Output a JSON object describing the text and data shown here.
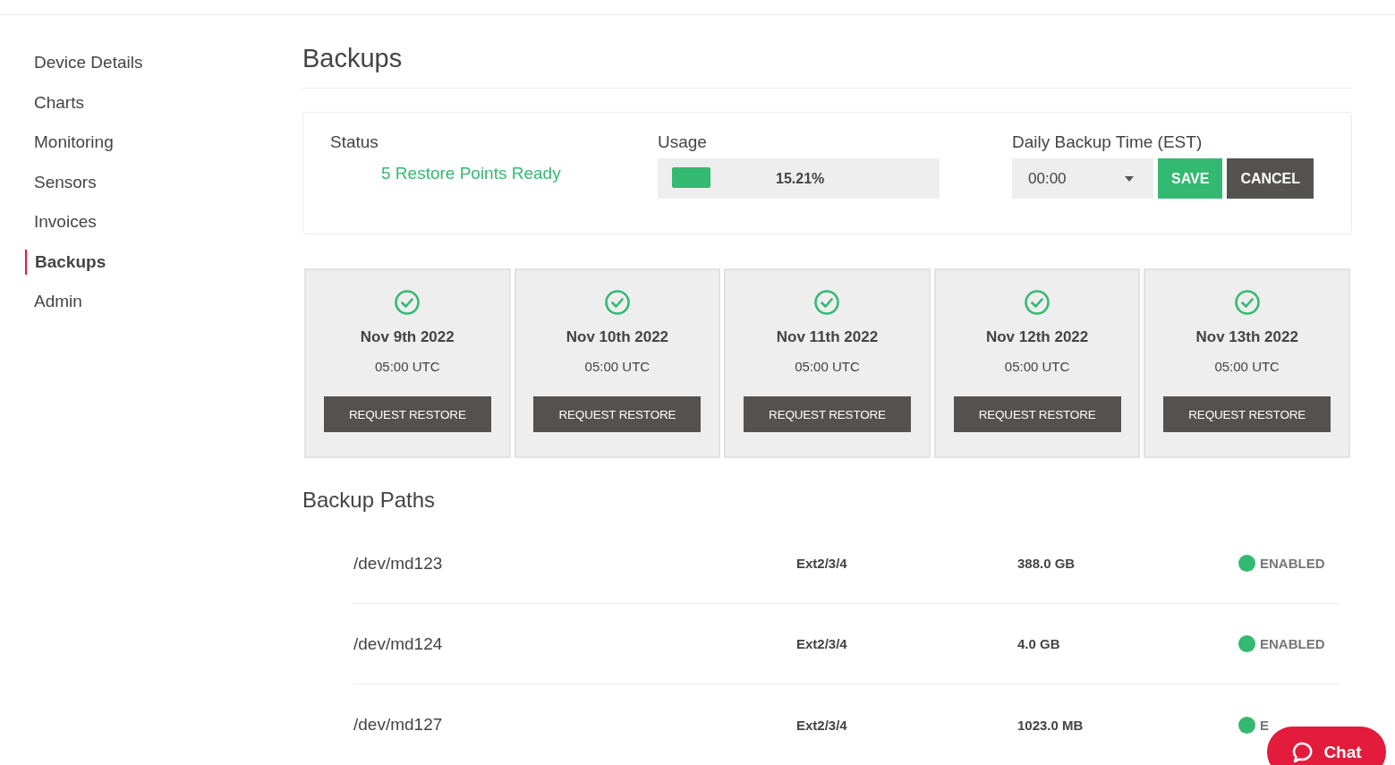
{
  "sidebar": {
    "items": [
      {
        "label": "Device Details",
        "selected": false
      },
      {
        "label": "Charts",
        "selected": false
      },
      {
        "label": "Monitoring",
        "selected": false
      },
      {
        "label": "Sensors",
        "selected": false
      },
      {
        "label": "Invoices",
        "selected": false
      },
      {
        "label": "Backups",
        "selected": true
      },
      {
        "label": "Admin",
        "selected": false
      }
    ]
  },
  "title": "Backups",
  "summary": {
    "status_label": "Status",
    "status": "5 Restore Points Ready",
    "usage_label": "Usage",
    "usage": {
      "level": 0.1521,
      "reading": "15.21%"
    },
    "time_label": "Daily Backup Time (EST)",
    "time_value": "00:00",
    "save": "SAVE",
    "cancel": "CANCEL"
  },
  "restore_points": [
    {
      "date": "Nov 9th 2022",
      "time": "05:00 UTC",
      "action": "REQUEST RESTORE"
    },
    {
      "date": "Nov 10th 2022",
      "time": "05:00 UTC",
      "action": "REQUEST RESTORE"
    },
    {
      "date": "Nov 11th 2022",
      "time": "05:00 UTC",
      "action": "REQUEST RESTORE"
    },
    {
      "date": "Nov 12th 2022",
      "time": "05:00 UTC",
      "action": "REQUEST RESTORE"
    },
    {
      "date": "Nov 13th 2022",
      "time": "05:00 UTC",
      "action": "REQUEST RESTORE"
    }
  ],
  "paths_title": "Backup Paths",
  "paths": [
    {
      "path": "/dev/md123",
      "filesystem": "Ext2/3/4",
      "size": "388.0 GB",
      "status": "ENABLED",
      "color": "#33b972"
    },
    {
      "path": "/dev/md124",
      "filesystem": "Ext2/3/4",
      "size": "4.0 GB",
      "status": "ENABLED",
      "color": "#33b972"
    },
    {
      "path": "/dev/md127",
      "filesystem": "Ext2/3/4",
      "size": "1023.0 MB",
      "status": "E",
      "color": "#33b972"
    }
  ],
  "chat": {
    "label": "Chat"
  }
}
